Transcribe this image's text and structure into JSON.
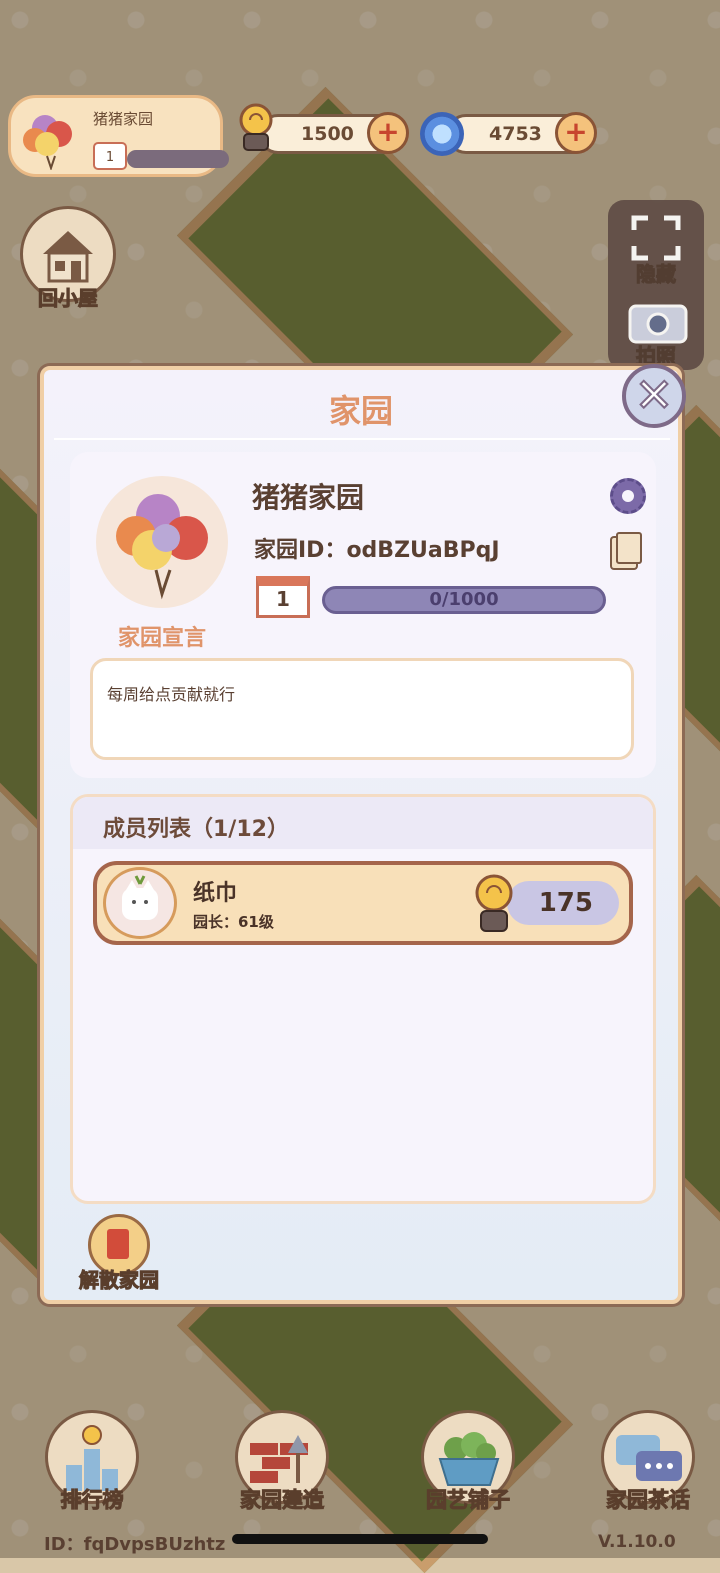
{
  "hud": {
    "home_name": "猪猪家园",
    "home_level": "1",
    "coins": "1500",
    "gems": "4753",
    "plus": "+"
  },
  "side": {
    "back_home": "回小屋",
    "hide": "隐藏",
    "photo": "拍照"
  },
  "modal": {
    "title": "家园",
    "close": "✕",
    "home_name": "猪猪家园",
    "home_id": "家园ID：odBZUaBPqJ",
    "level": "1",
    "exp": "0/1000",
    "declaration_label": "家园宣言",
    "declaration": "每周给点贡献就行",
    "members_header": "成员列表（1/12）",
    "members": [
      {
        "name": "纸巾",
        "role": "园长：61级",
        "score": "175"
      }
    ],
    "dissolve_label": "解散家园"
  },
  "bottom_nav": {
    "rank": "排行榜",
    "build": "家园建造",
    "shop": "园艺铺子",
    "chat": "家园茶话"
  },
  "footer": {
    "user_id": "ID：fqDvpsBUzhtz",
    "version": "V.1.10.0"
  },
  "colors": {
    "accent": "#e0946a",
    "brown": "#5a4032",
    "exp_bar": "#8e86b6"
  }
}
